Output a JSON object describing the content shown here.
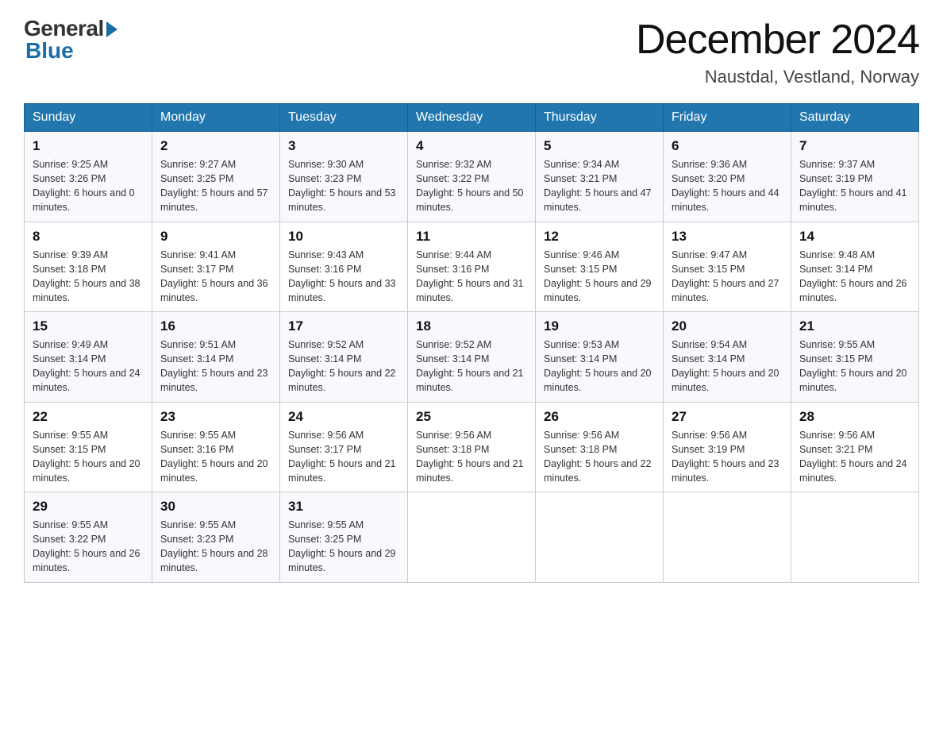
{
  "logo": {
    "general": "General",
    "blue": "Blue"
  },
  "header": {
    "month_year": "December 2024",
    "location": "Naustdal, Vestland, Norway"
  },
  "days_of_week": [
    "Sunday",
    "Monday",
    "Tuesday",
    "Wednesday",
    "Thursday",
    "Friday",
    "Saturday"
  ],
  "weeks": [
    [
      {
        "num": "1",
        "sunrise": "9:25 AM",
        "sunset": "3:26 PM",
        "daylight": "6 hours and 0 minutes."
      },
      {
        "num": "2",
        "sunrise": "9:27 AM",
        "sunset": "3:25 PM",
        "daylight": "5 hours and 57 minutes."
      },
      {
        "num": "3",
        "sunrise": "9:30 AM",
        "sunset": "3:23 PM",
        "daylight": "5 hours and 53 minutes."
      },
      {
        "num": "4",
        "sunrise": "9:32 AM",
        "sunset": "3:22 PM",
        "daylight": "5 hours and 50 minutes."
      },
      {
        "num": "5",
        "sunrise": "9:34 AM",
        "sunset": "3:21 PM",
        "daylight": "5 hours and 47 minutes."
      },
      {
        "num": "6",
        "sunrise": "9:36 AM",
        "sunset": "3:20 PM",
        "daylight": "5 hours and 44 minutes."
      },
      {
        "num": "7",
        "sunrise": "9:37 AM",
        "sunset": "3:19 PM",
        "daylight": "5 hours and 41 minutes."
      }
    ],
    [
      {
        "num": "8",
        "sunrise": "9:39 AM",
        "sunset": "3:18 PM",
        "daylight": "5 hours and 38 minutes."
      },
      {
        "num": "9",
        "sunrise": "9:41 AM",
        "sunset": "3:17 PM",
        "daylight": "5 hours and 36 minutes."
      },
      {
        "num": "10",
        "sunrise": "9:43 AM",
        "sunset": "3:16 PM",
        "daylight": "5 hours and 33 minutes."
      },
      {
        "num": "11",
        "sunrise": "9:44 AM",
        "sunset": "3:16 PM",
        "daylight": "5 hours and 31 minutes."
      },
      {
        "num": "12",
        "sunrise": "9:46 AM",
        "sunset": "3:15 PM",
        "daylight": "5 hours and 29 minutes."
      },
      {
        "num": "13",
        "sunrise": "9:47 AM",
        "sunset": "3:15 PM",
        "daylight": "5 hours and 27 minutes."
      },
      {
        "num": "14",
        "sunrise": "9:48 AM",
        "sunset": "3:14 PM",
        "daylight": "5 hours and 26 minutes."
      }
    ],
    [
      {
        "num": "15",
        "sunrise": "9:49 AM",
        "sunset": "3:14 PM",
        "daylight": "5 hours and 24 minutes."
      },
      {
        "num": "16",
        "sunrise": "9:51 AM",
        "sunset": "3:14 PM",
        "daylight": "5 hours and 23 minutes."
      },
      {
        "num": "17",
        "sunrise": "9:52 AM",
        "sunset": "3:14 PM",
        "daylight": "5 hours and 22 minutes."
      },
      {
        "num": "18",
        "sunrise": "9:52 AM",
        "sunset": "3:14 PM",
        "daylight": "5 hours and 21 minutes."
      },
      {
        "num": "19",
        "sunrise": "9:53 AM",
        "sunset": "3:14 PM",
        "daylight": "5 hours and 20 minutes."
      },
      {
        "num": "20",
        "sunrise": "9:54 AM",
        "sunset": "3:14 PM",
        "daylight": "5 hours and 20 minutes."
      },
      {
        "num": "21",
        "sunrise": "9:55 AM",
        "sunset": "3:15 PM",
        "daylight": "5 hours and 20 minutes."
      }
    ],
    [
      {
        "num": "22",
        "sunrise": "9:55 AM",
        "sunset": "3:15 PM",
        "daylight": "5 hours and 20 minutes."
      },
      {
        "num": "23",
        "sunrise": "9:55 AM",
        "sunset": "3:16 PM",
        "daylight": "5 hours and 20 minutes."
      },
      {
        "num": "24",
        "sunrise": "9:56 AM",
        "sunset": "3:17 PM",
        "daylight": "5 hours and 21 minutes."
      },
      {
        "num": "25",
        "sunrise": "9:56 AM",
        "sunset": "3:18 PM",
        "daylight": "5 hours and 21 minutes."
      },
      {
        "num": "26",
        "sunrise": "9:56 AM",
        "sunset": "3:18 PM",
        "daylight": "5 hours and 22 minutes."
      },
      {
        "num": "27",
        "sunrise": "9:56 AM",
        "sunset": "3:19 PM",
        "daylight": "5 hours and 23 minutes."
      },
      {
        "num": "28",
        "sunrise": "9:56 AM",
        "sunset": "3:21 PM",
        "daylight": "5 hours and 24 minutes."
      }
    ],
    [
      {
        "num": "29",
        "sunrise": "9:55 AM",
        "sunset": "3:22 PM",
        "daylight": "5 hours and 26 minutes."
      },
      {
        "num": "30",
        "sunrise": "9:55 AM",
        "sunset": "3:23 PM",
        "daylight": "5 hours and 28 minutes."
      },
      {
        "num": "31",
        "sunrise": "9:55 AM",
        "sunset": "3:25 PM",
        "daylight": "5 hours and 29 minutes."
      },
      null,
      null,
      null,
      null
    ]
  ]
}
